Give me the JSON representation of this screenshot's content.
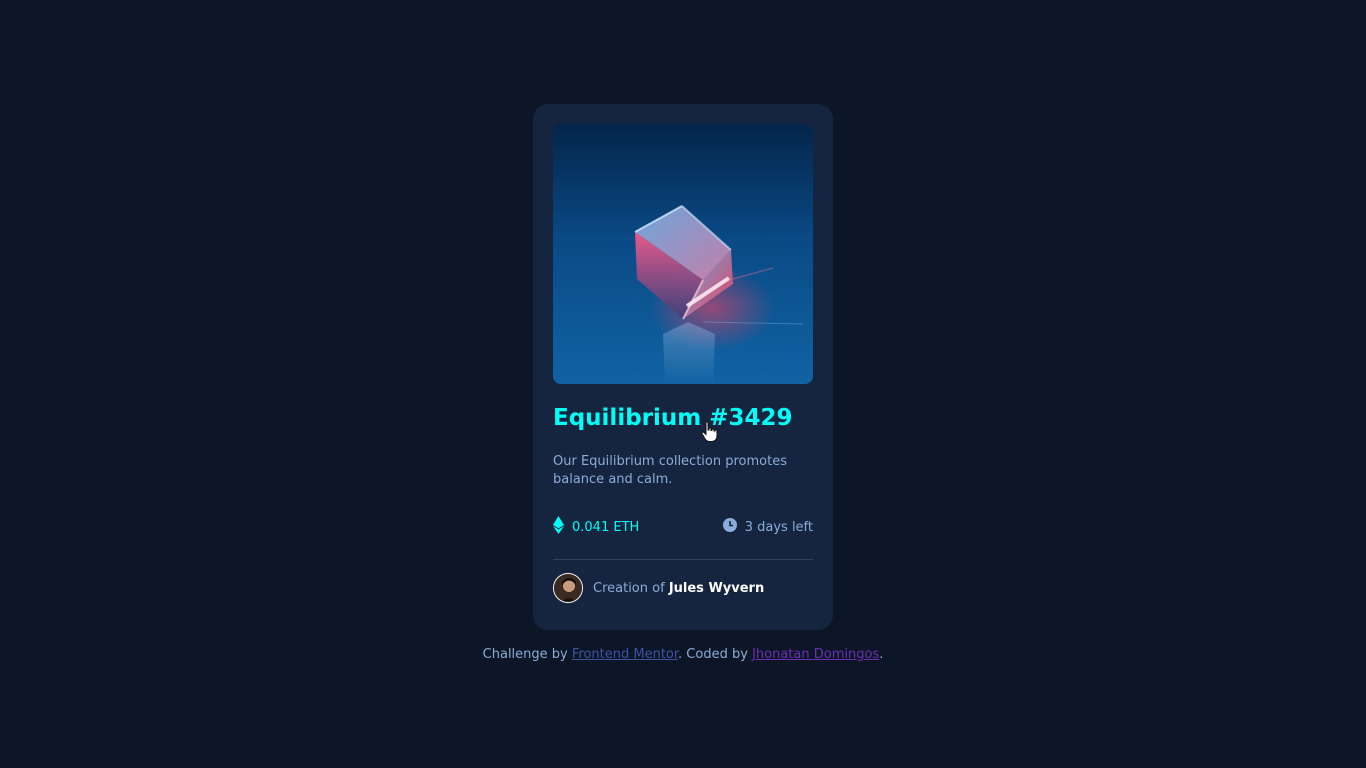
{
  "card": {
    "image_alt": "Equilibrium crystal cube",
    "title": "Equilibrium #3429",
    "description": "Our Equilibrium collection promotes balance and calm.",
    "price": "0.041 ETH",
    "time_left": "3 days left",
    "creator_prefix": "Creation of",
    "creator_name": "Jules Wyvern",
    "icons": {
      "price": "ethereum-icon",
      "time": "clock-icon"
    }
  },
  "attribution": {
    "prefix": "Challenge by",
    "link1": "Frontend Mentor",
    "middle": ". Coded by",
    "link2": "Jhonatan Domingos",
    "suffix": "."
  },
  "colors": {
    "background": "#0d1627",
    "card": "#15253f",
    "accent": "#00fff8",
    "soft_blue": "#8bacd9",
    "divider": "#2e405a"
  }
}
